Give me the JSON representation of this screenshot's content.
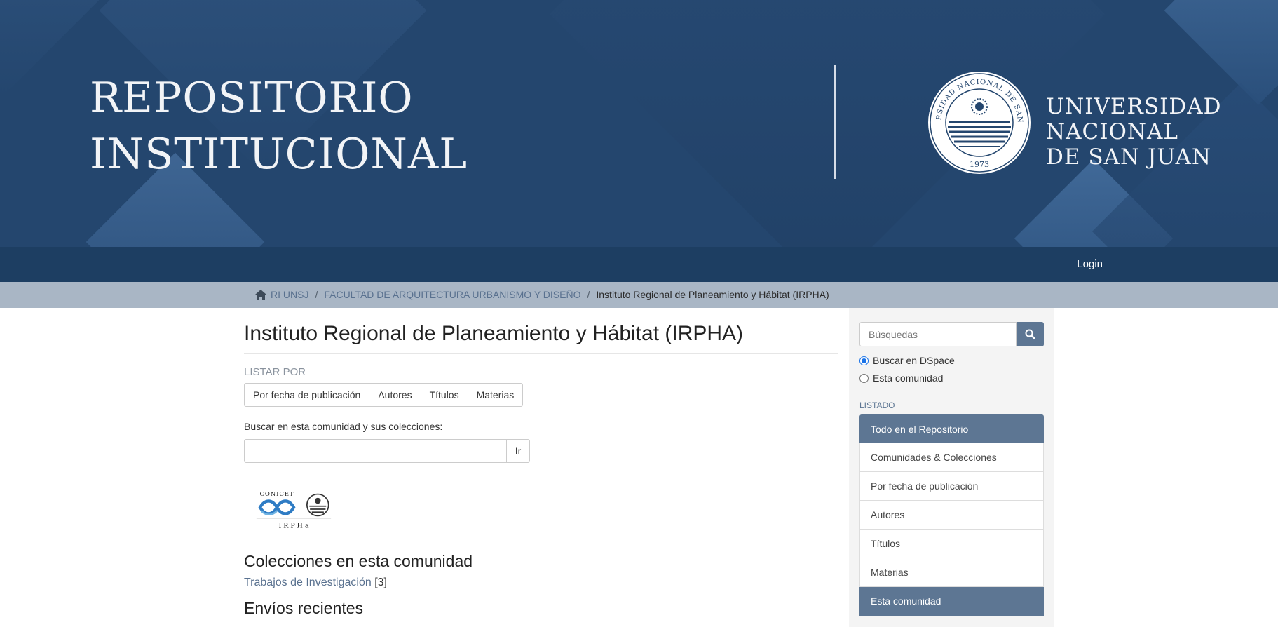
{
  "banner": {
    "title_line1": "REPOSITORIO",
    "title_line2": "INSTITUCIONAL",
    "uni_line1": "UNIVERSIDAD",
    "uni_line2": "NACIONAL",
    "uni_line3": "DE SAN JUAN",
    "seal_text": "UNIVERSIDAD NACIONAL DE SAN JUAN",
    "seal_year": "1973"
  },
  "topnav": {
    "login": "Login"
  },
  "breadcrumb": {
    "items": [
      "RI UNSJ",
      "FACULTAD DE ARQUITECTURA URBANISMO Y DISEÑO"
    ],
    "current": "Instituto Regional de Planeamiento y Hábitat (IRPHA)",
    "separator": "/"
  },
  "main": {
    "title": "Instituto Regional de Planeamiento y Hábitat (IRPHA)",
    "listar_label": "LISTAR POR",
    "browse_buttons": [
      "Por fecha de publicación",
      "Autores",
      "Títulos",
      "Materias"
    ],
    "search_label": "Buscar en esta comunidad y sus colecciones:",
    "search_value": "",
    "go_label": "Ir",
    "logo": {
      "text_top": "CONICET",
      "text_bottom": "I R P H a"
    },
    "collections_heading": "Colecciones en esta comunidad",
    "collection_link": "Trabajos de Investigación",
    "collection_count": "[3]",
    "recent_heading": "Envíos recientes"
  },
  "sidebar": {
    "search_placeholder": "Búsquedas",
    "radio_dspace": "Buscar en DSpace",
    "radio_community": "Esta comunidad",
    "listado_heading": "LISTADO",
    "items": [
      "Todo en el Repositorio",
      "Comunidades & Colecciones",
      "Por fecha de publicación",
      "Autores",
      "Títulos",
      "Materias",
      "Esta comunidad"
    ]
  },
  "colors": {
    "banner_bg": "#24466e",
    "nav_bg": "#1d3e62",
    "breadcrumb_bg": "#a9b6c5",
    "accent": "#5d7693",
    "link": "#59718f"
  }
}
